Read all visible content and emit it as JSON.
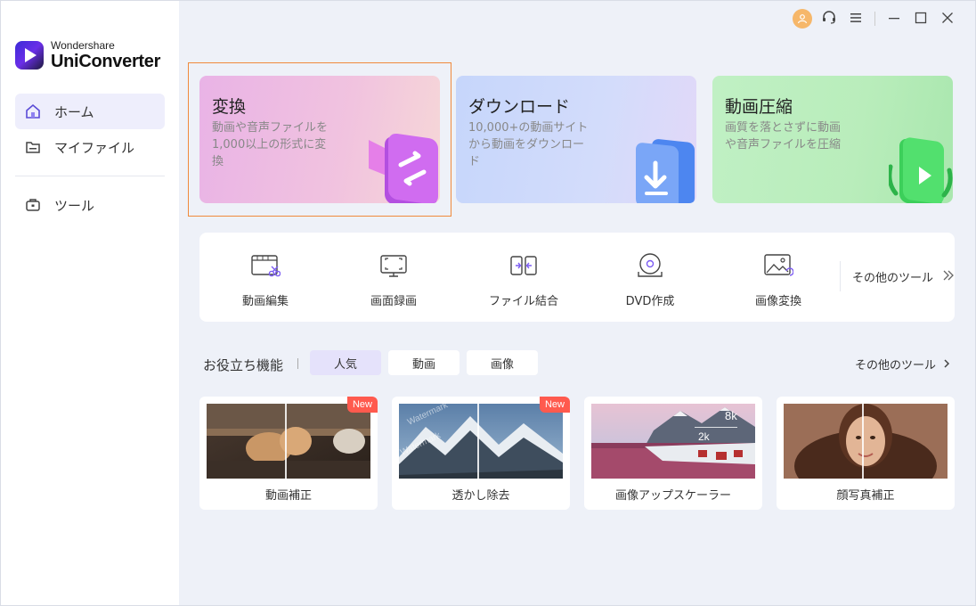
{
  "app": {
    "brand": "Wondershare",
    "product": "UniConverter"
  },
  "sidebar": {
    "items": [
      {
        "label": "ホーム",
        "icon": "home-icon",
        "active": true
      },
      {
        "label": "マイファイル",
        "icon": "folder-icon",
        "active": false
      },
      {
        "label": "ツール",
        "icon": "toolbox-icon",
        "active": false
      }
    ]
  },
  "titlebar": {
    "icons": [
      "avatar-icon",
      "headset-icon",
      "menu-icon",
      "minimize-icon",
      "maximize-icon",
      "close-icon"
    ]
  },
  "feature_cards": [
    {
      "title": "変換",
      "desc": "動画や音声ファイルを1,000以上の形式に変換"
    },
    {
      "title": "ダウンロード",
      "desc": "10,000+の動画サイトから動画をダウンロード"
    },
    {
      "title": "動画圧縮",
      "desc": "画質を落とさずに動画や音声ファイルを圧縮"
    }
  ],
  "tools": {
    "items": [
      {
        "label": "動画編集",
        "icon": "video-edit-icon"
      },
      {
        "label": "画面録画",
        "icon": "screen-record-icon"
      },
      {
        "label": "ファイル結合",
        "icon": "merge-icon"
      },
      {
        "label": "DVD作成",
        "icon": "dvd-icon"
      },
      {
        "label": "画像変換",
        "icon": "image-convert-icon"
      }
    ],
    "more_label": "その他のツール"
  },
  "section": {
    "title": "お役立ち機能",
    "tabs": [
      "人気",
      "動画",
      "画像"
    ],
    "active_tab": "人気",
    "more_label": "その他のツール"
  },
  "feature_thumbs": [
    {
      "label": "動画補正",
      "badge": "New"
    },
    {
      "label": "透かし除去",
      "badge": "New",
      "watermark": "Watermark"
    },
    {
      "label": "画像アップスケーラー",
      "tags": [
        "8k",
        "2k"
      ]
    },
    {
      "label": "顔写真補正"
    }
  ],
  "colors": {
    "accent": "#6a4cf0",
    "selection_border": "#f08a3c",
    "new_badge": "#ff5a4e"
  }
}
